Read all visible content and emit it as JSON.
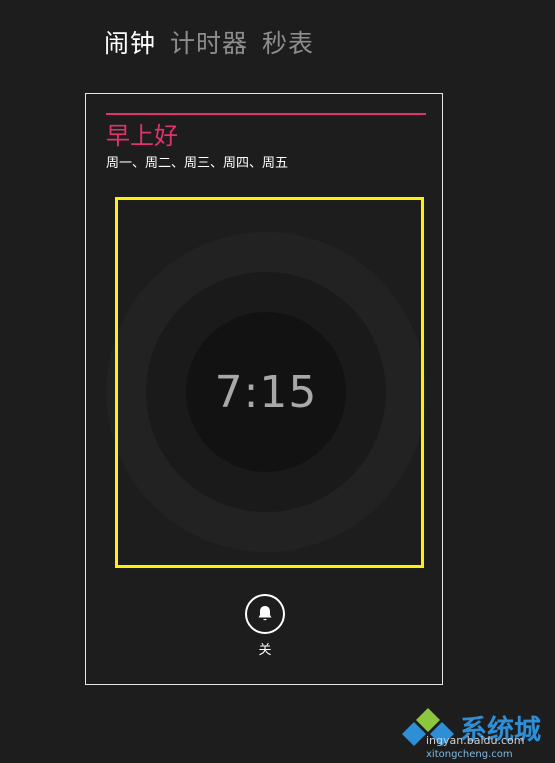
{
  "tabs": [
    {
      "label": "闹钟",
      "active": true
    },
    {
      "label": "计时器",
      "active": false
    },
    {
      "label": "秒表",
      "active": false
    }
  ],
  "alarm": {
    "name": "早上好",
    "days": "周一、周二、周三、周四、周五",
    "time": "7:15",
    "toggle_icon": "bell-icon",
    "toggle_label": "关"
  },
  "watermark": {
    "brand": "系统城",
    "site": "ingyan.baidu.com",
    "domain": "xitongcheng.com"
  },
  "colors": {
    "background": "#1d1d1d",
    "accent": "#e0336b",
    "highlight": "#ffef0a",
    "tab_inactive": "#8d8d8d"
  }
}
